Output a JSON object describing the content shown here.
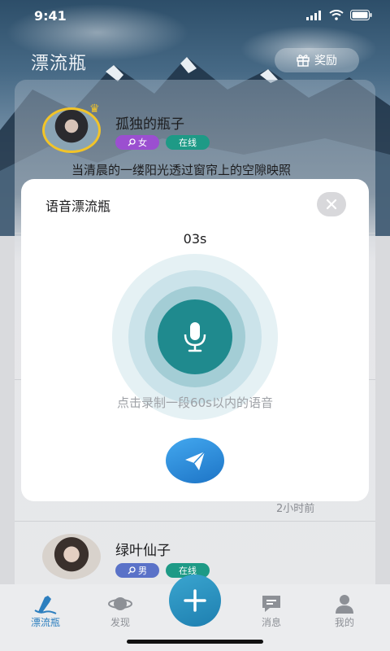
{
  "status_bar": {
    "time": "9:41"
  },
  "header": {
    "title": "漂流瓶",
    "reward_label": "奖励"
  },
  "feed": {
    "posts": [
      {
        "user": "孤独的瓶子",
        "gender_label": "女",
        "status_label": "在线",
        "text": "当清晨的一缕阳光透过窗帘上的空隙映照"
      },
      {
        "time": "2小时前"
      },
      {
        "user": "绿叶仙子",
        "gender_label": "男",
        "status_label": "在线"
      }
    ]
  },
  "voice_modal": {
    "title": "语音漂流瓶",
    "timer": "03s",
    "hint": "点击录制一段60s以内的语音"
  },
  "bottom_nav": {
    "items": [
      {
        "label": "漂流瓶"
      },
      {
        "label": "发现"
      },
      {
        "label": "消息"
      },
      {
        "label": "我的"
      }
    ]
  },
  "colors": {
    "accent": "#1f8a8e",
    "tag_female": "#9b4fd0",
    "tag_male": "#5a72c8",
    "tag_online": "#1e9a86",
    "send": "#2a8ad8"
  }
}
